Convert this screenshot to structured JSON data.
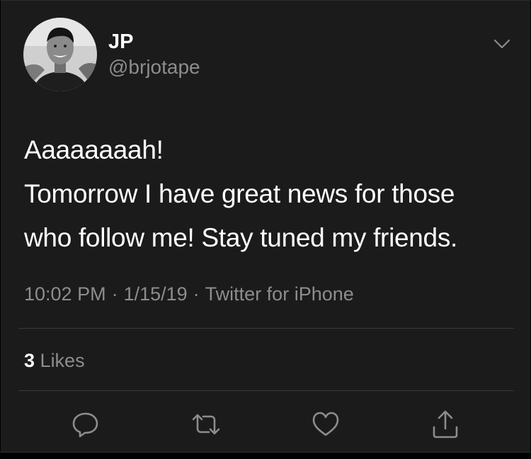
{
  "author": {
    "name": "JP",
    "handle": "@brjotape"
  },
  "tweet": {
    "lines": [
      "Aaaaaaaah!",
      "Tomorrow I have great news for those",
      "who follow me! Stay tuned my friends."
    ]
  },
  "meta": {
    "time": "10:02 PM",
    "date": "1/15/19",
    "source": "Twitter for iPhone",
    "separator": "·"
  },
  "stats": {
    "likes_count": "3",
    "likes_label": "Likes"
  },
  "actions": [
    {
      "icon": "reply-icon"
    },
    {
      "icon": "retweet-icon"
    },
    {
      "icon": "like-heart-icon"
    },
    {
      "icon": "share-icon"
    }
  ],
  "icons": {
    "menu": "chevron-down-icon",
    "avatar": "avatar-photo"
  },
  "colors": {
    "background": "#1b1b1b",
    "text_primary": "#ffffff",
    "text_secondary": "#8d8d8d",
    "divider": "#3a3a3a",
    "icon": "#8d8d8d"
  }
}
